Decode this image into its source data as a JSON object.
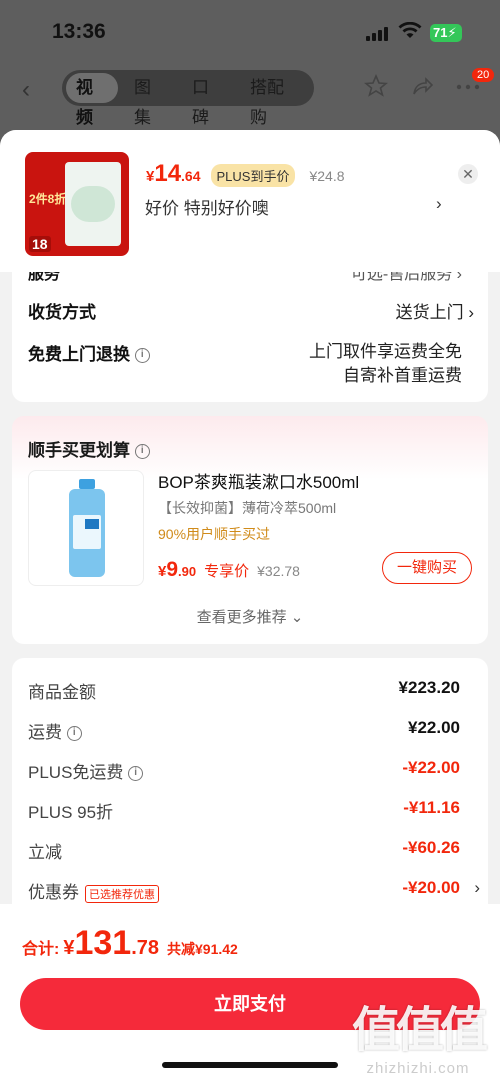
{
  "status_bar": {
    "time": "13:36",
    "battery": "71"
  },
  "nav": {
    "tabs": [
      "视频",
      "图集",
      "口碑",
      "搭配购"
    ],
    "active_tab": 0,
    "cart_badge": "20"
  },
  "product": {
    "thumb_text1": "2件8折",
    "thumb_text2": "18",
    "currency": "¥",
    "price_int": "14",
    "price_dec": ".64",
    "plus_tag": "PLUS到手价",
    "original_price": "¥24.8",
    "promo_text": "好价  特别好价噢"
  },
  "service": {
    "clipped_row": "服务",
    "clipped_val": "可选-售后服务 ›",
    "delivery_label": "收货方式",
    "delivery_value": "送货上门",
    "return_label": "免费上门退换",
    "return_line1": "上门取件享运费全免",
    "return_line2": "自寄补首重运费"
  },
  "recommend": {
    "title": "顺手买更划算",
    "name": "BOP茶爽瓶装漱口水500ml",
    "sub": "【长效抑菌】薄荷冷萃500ml",
    "buy_stat": "90%用户顺手买过",
    "currency": "¥",
    "price_int": "9",
    "price_dec": ".90",
    "price_tag": "专享价",
    "original_price": "¥32.78",
    "buy_button": "一键购买",
    "more": "查看更多推荐 ⌄"
  },
  "fees": [
    {
      "label": "商品金额",
      "value": "¥223.20",
      "red": false,
      "info": false
    },
    {
      "label": "运费",
      "value": "¥22.00",
      "red": false,
      "info": true
    },
    {
      "label": "PLUS免运费",
      "value": "-¥22.00",
      "red": true,
      "info": true
    },
    {
      "label": "PLUS 95折",
      "value": "-¥11.16",
      "red": true,
      "info": false
    },
    {
      "label": "立减",
      "value": "-¥60.26",
      "red": true,
      "info": false
    },
    {
      "label": "优惠券",
      "value": "-¥20.00",
      "red": true,
      "info": false
    }
  ],
  "coupon_tag": "已选推荐优惠",
  "footer": {
    "total_label": "合计:",
    "currency": "¥",
    "total_int": "131",
    "total_dec": ".78",
    "saved": "共减¥91.42",
    "pay_button": "立即支付"
  },
  "watermark": {
    "big": "值值值",
    "small": "zhizhizhi.com"
  },
  "colors": {
    "accent": "#f2270c",
    "pay_button": "#f52a3a",
    "plus_tag_bg": "#f9e3a6"
  }
}
